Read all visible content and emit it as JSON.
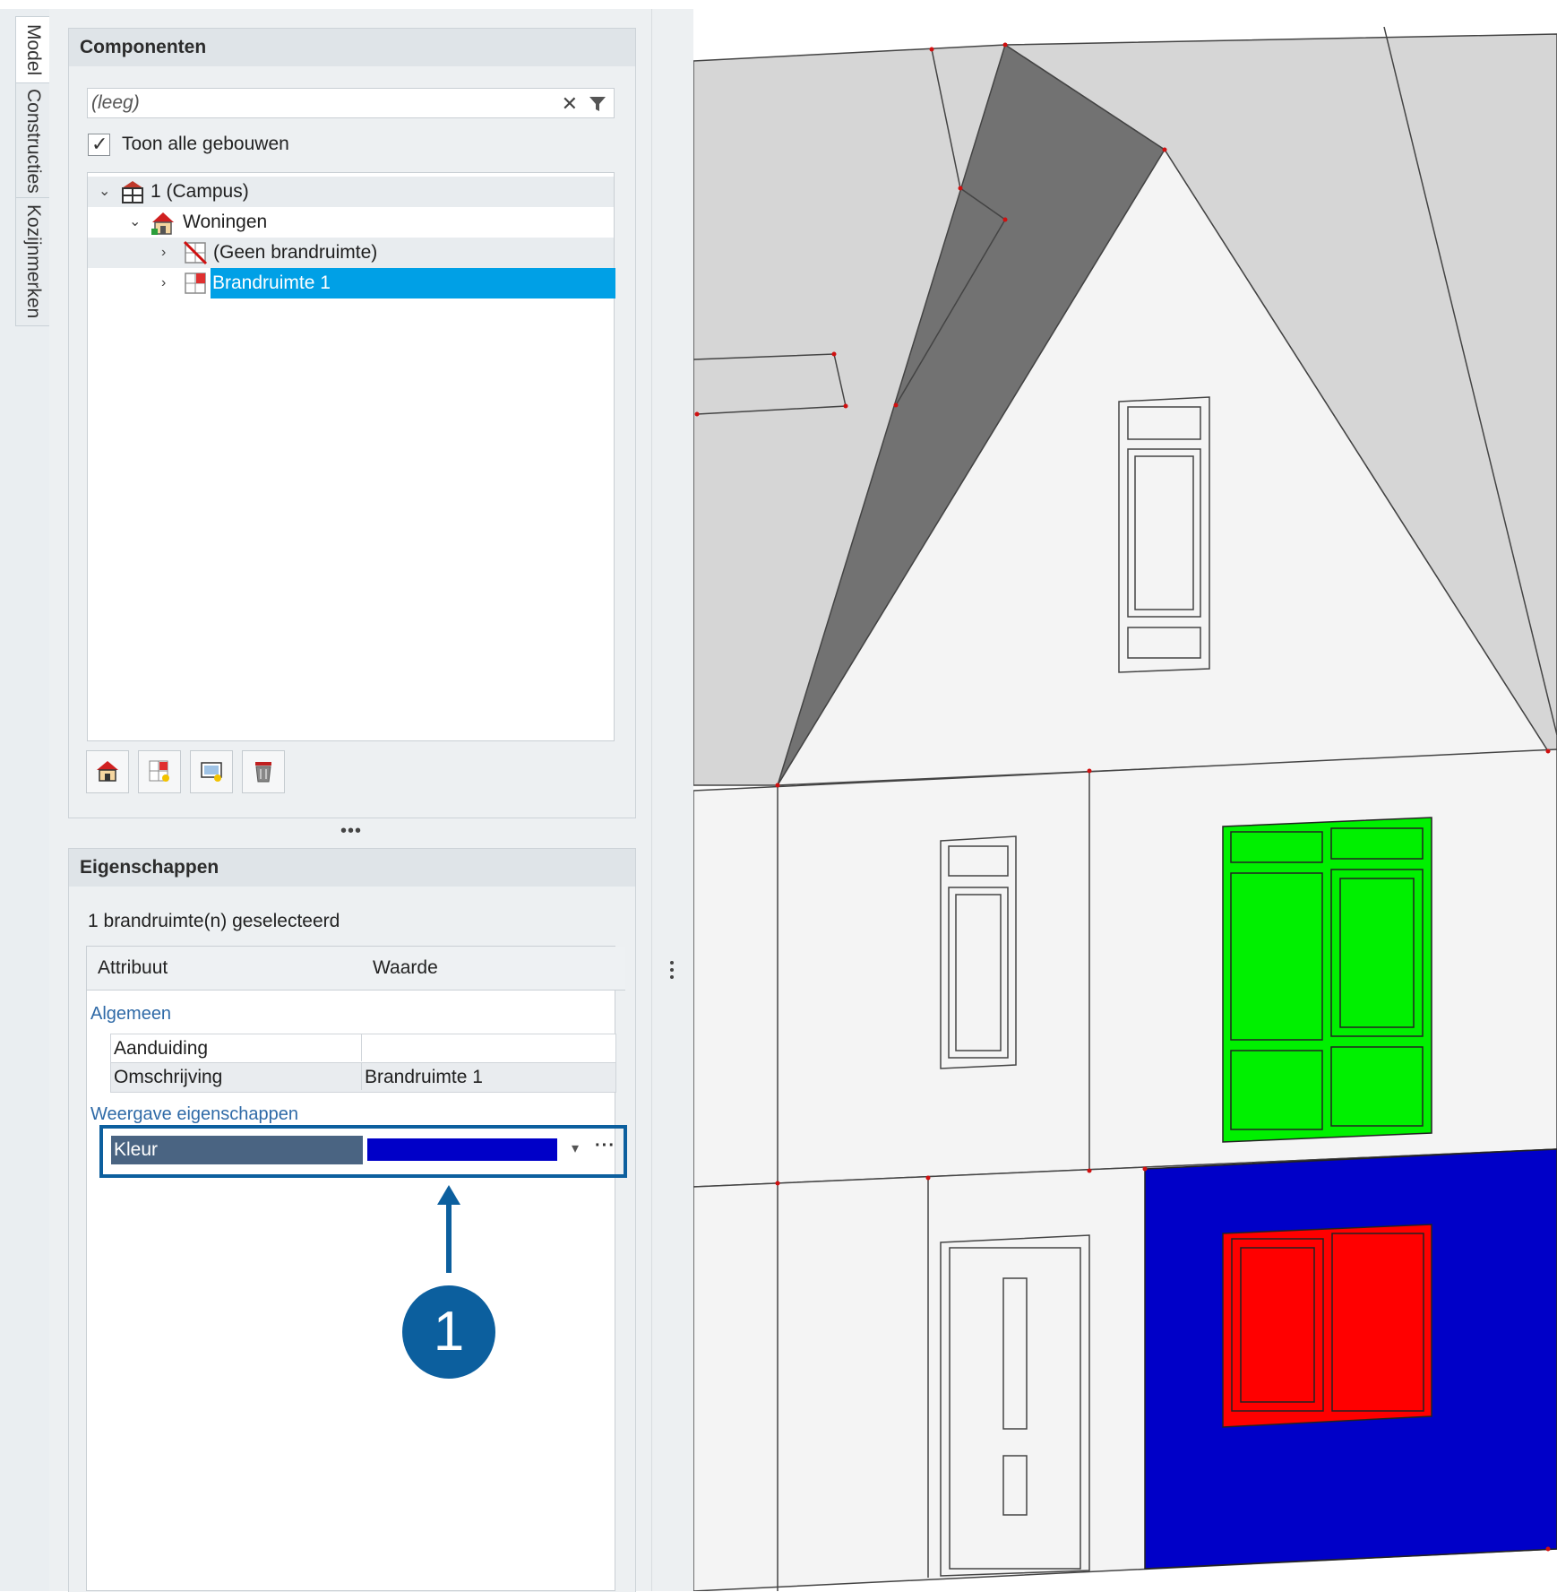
{
  "side_tabs": [
    "Model",
    "Constructies",
    "Kozijnmerken"
  ],
  "components": {
    "title": "Componenten",
    "search": {
      "value": "",
      "placeholder": "(leeg)"
    },
    "show_all": {
      "label": "Toon alle gebouwen",
      "checked": true
    },
    "tree": [
      {
        "label": "1 (Campus)",
        "icon": "campus-icon",
        "level": 0,
        "expanded": true
      },
      {
        "label": "Woningen",
        "icon": "house-icon",
        "level": 1,
        "expanded": true
      },
      {
        "label": "(Geen brandruimte)",
        "icon": "no-fire-compartment-icon",
        "level": 2,
        "expanded": false
      },
      {
        "label": "Brandruimte 1",
        "icon": "fire-compartment-icon",
        "level": 2,
        "expanded": false,
        "selected": true
      }
    ],
    "toolbar": [
      "add-building-icon",
      "add-fire-compartment-icon",
      "add-view-icon",
      "delete-icon"
    ]
  },
  "properties": {
    "title": "Eigenschappen",
    "selection_count": "1 brandruimte(n) geselecteerd",
    "columns": [
      "Attribuut",
      "Waarde"
    ],
    "groups": [
      {
        "name": "Algemeen",
        "rows": [
          {
            "key": "Aanduiding",
            "value": ""
          },
          {
            "key": "Omschrijving",
            "value": "Brandruimte 1"
          }
        ]
      },
      {
        "name": "Weergave eigenschappen",
        "rows": [
          {
            "key": "Kleur",
            "value_color": "#0000c8"
          }
        ]
      }
    ]
  },
  "callout": {
    "number": "1",
    "color": "#0c5f9e"
  },
  "viewport": {
    "colors": {
      "roof_light": "#d6d6d6",
      "roof_dark": "#727272",
      "wall": "#f4f4f4",
      "window_green": "#00f000",
      "window_red": "#ff0000",
      "compartment_blue": "#0000c8"
    }
  }
}
